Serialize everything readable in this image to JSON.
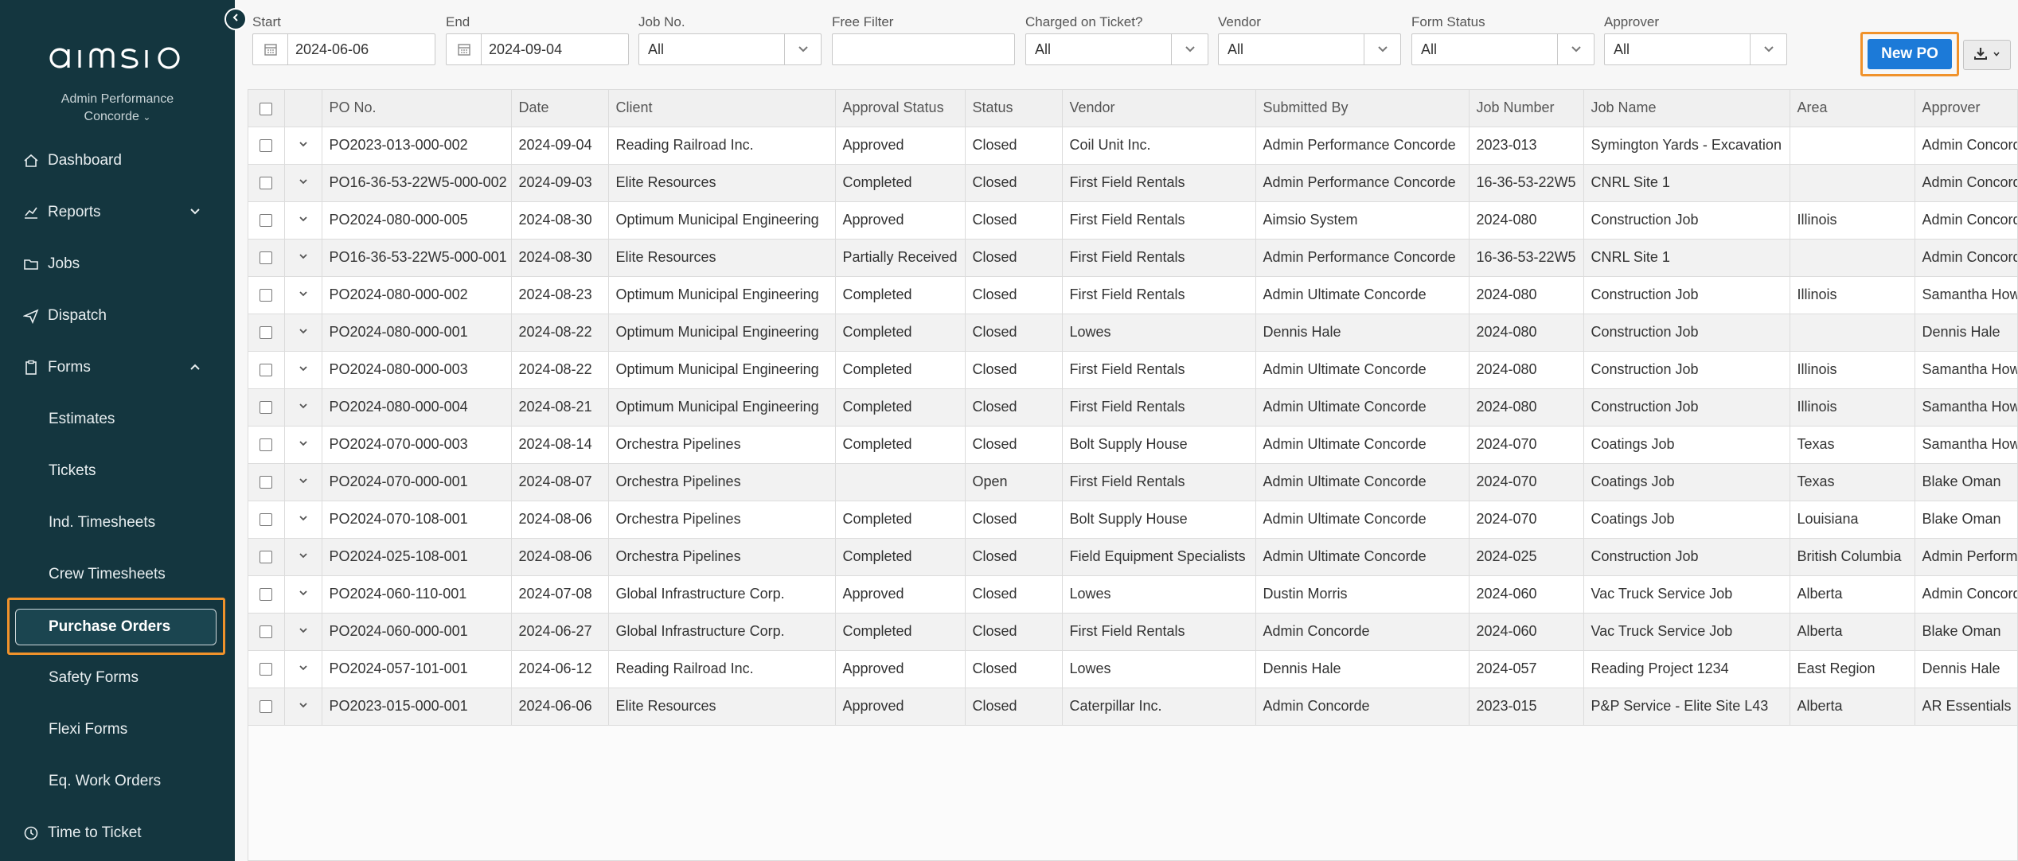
{
  "sidebar": {
    "account_line1": "Admin Performance",
    "account_line2": "Concorde",
    "nav": [
      {
        "label": "Dashboard",
        "icon": "home-icon"
      },
      {
        "label": "Reports",
        "icon": "chart-icon"
      },
      {
        "label": "Jobs",
        "icon": "folder-icon"
      },
      {
        "label": "Dispatch",
        "icon": "send-icon"
      },
      {
        "label": "Forms",
        "icon": "clipboard-icon"
      }
    ],
    "forms_items": [
      "Estimates",
      "Tickets",
      "Ind. Timesheets",
      "Crew Timesheets",
      "Purchase Orders",
      "Safety Forms",
      "Flexi Forms",
      "Eq. Work Orders"
    ],
    "bottom": {
      "label": "Time to Ticket",
      "icon": "clock-icon"
    }
  },
  "filters": {
    "start": {
      "label": "Start",
      "value": "2024-06-06"
    },
    "end": {
      "label": "End",
      "value": "2024-09-04"
    },
    "job_no": {
      "label": "Job No.",
      "value": "All"
    },
    "free_filter": {
      "label": "Free Filter",
      "value": ""
    },
    "charged": {
      "label": "Charged on Ticket?",
      "value": "All"
    },
    "vendor": {
      "label": "Vendor",
      "value": "All"
    },
    "form_status": {
      "label": "Form Status",
      "value": "All"
    },
    "approver": {
      "label": "Approver",
      "value": "All"
    }
  },
  "actions": {
    "new_po": "New PO"
  },
  "colors": {
    "sidebar_bg": "#14363f",
    "primary": "#1c7ad8",
    "highlight": "#f0922b"
  },
  "table": {
    "columns": [
      "PO No.",
      "Date",
      "Client",
      "Approval Status",
      "Status",
      "Vendor",
      "Submitted By",
      "Job Number",
      "Job Name",
      "Area",
      "Approver"
    ],
    "rows": [
      [
        "PO2023-013-000-002",
        "2024-09-04",
        "Reading Railroad Inc.",
        "Approved",
        "Closed",
        "Coil Unit Inc.",
        "Admin Performance Concorde",
        "2023-013",
        "Symington Yards - Excavation",
        "",
        "Admin Concorde"
      ],
      [
        "PO16-36-53-22W5-000-002",
        "2024-09-03",
        "Elite Resources",
        "Completed",
        "Closed",
        "First Field Rentals",
        "Admin Performance Concorde",
        "16-36-53-22W5",
        "CNRL Site 1",
        "",
        "Admin Concorde"
      ],
      [
        "PO2024-080-000-005",
        "2024-08-30",
        "Optimum Municipal Engineering",
        "Approved",
        "Closed",
        "First Field Rentals",
        "Aimsio System",
        "2024-080",
        "Construction Job",
        "Illinois",
        "Admin Concorde"
      ],
      [
        "PO16-36-53-22W5-000-001",
        "2024-08-30",
        "Elite Resources",
        "Partially Received",
        "Closed",
        "First Field Rentals",
        "Admin Performance Concorde",
        "16-36-53-22W5",
        "CNRL Site 1",
        "",
        "Admin Concorde"
      ],
      [
        "PO2024-080-000-002",
        "2024-08-23",
        "Optimum Municipal Engineering",
        "Completed",
        "Closed",
        "First Field Rentals",
        "Admin Ultimate Concorde",
        "2024-080",
        "Construction Job",
        "Illinois",
        "Samantha Howell"
      ],
      [
        "PO2024-080-000-001",
        "2024-08-22",
        "Optimum Municipal Engineering",
        "Completed",
        "Closed",
        "Lowes",
        "Dennis Hale",
        "2024-080",
        "Construction Job",
        "",
        "Dennis Hale"
      ],
      [
        "PO2024-080-000-003",
        "2024-08-22",
        "Optimum Municipal Engineering",
        "Completed",
        "Closed",
        "First Field Rentals",
        "Admin Ultimate Concorde",
        "2024-080",
        "Construction Job",
        "Illinois",
        "Samantha Howell"
      ],
      [
        "PO2024-080-000-004",
        "2024-08-21",
        "Optimum Municipal Engineering",
        "Completed",
        "Closed",
        "First Field Rentals",
        "Admin Ultimate Concorde",
        "2024-080",
        "Construction Job",
        "Illinois",
        "Samantha Howell"
      ],
      [
        "PO2024-070-000-003",
        "2024-08-14",
        "Orchestra Pipelines",
        "Completed",
        "Closed",
        "Bolt Supply House",
        "Admin Ultimate Concorde",
        "2024-070",
        "Coatings Job",
        "Texas",
        "Samantha Howell"
      ],
      [
        "PO2024-070-000-001",
        "2024-08-07",
        "Orchestra Pipelines",
        "",
        "Open",
        "First Field Rentals",
        "Admin Ultimate Concorde",
        "2024-070",
        "Coatings Job",
        "Texas",
        "Blake Oman"
      ],
      [
        "PO2024-070-108-001",
        "2024-08-06",
        "Orchestra Pipelines",
        "Completed",
        "Closed",
        "Bolt Supply House",
        "Admin Ultimate Concorde",
        "2024-070",
        "Coatings Job",
        "Louisiana",
        "Blake Oman"
      ],
      [
        "PO2024-025-108-001",
        "2024-08-06",
        "Orchestra Pipelines",
        "Completed",
        "Closed",
        "Field Equipment Specialists",
        "Admin Ultimate Concorde",
        "2024-025",
        "Construction Job",
        "British Columbia",
        "Admin Performance"
      ],
      [
        "PO2024-060-110-001",
        "2024-07-08",
        "Global Infrastructure Corp.",
        "Approved",
        "Closed",
        "Lowes",
        "Dustin Morris",
        "2024-060",
        "Vac Truck Service Job",
        "Alberta",
        "Admin Concorde"
      ],
      [
        "PO2024-060-000-001",
        "2024-06-27",
        "Global Infrastructure Corp.",
        "Completed",
        "Closed",
        "First Field Rentals",
        "Admin Concorde",
        "2024-060",
        "Vac Truck Service Job",
        "Alberta",
        "Blake Oman"
      ],
      [
        "PO2024-057-101-001",
        "2024-06-12",
        "Reading Railroad Inc.",
        "Approved",
        "Closed",
        "Lowes",
        "Dennis Hale",
        "2024-057",
        "Reading Project 1234",
        "East Region",
        "Dennis Hale"
      ],
      [
        "PO2023-015-000-001",
        "2024-06-06",
        "Elite Resources",
        "Approved",
        "Closed",
        "Caterpillar Inc.",
        "Admin Concorde",
        "2023-015",
        "P&P Service - Elite Site L43",
        "Alberta",
        "AR Essentials"
      ]
    ]
  }
}
